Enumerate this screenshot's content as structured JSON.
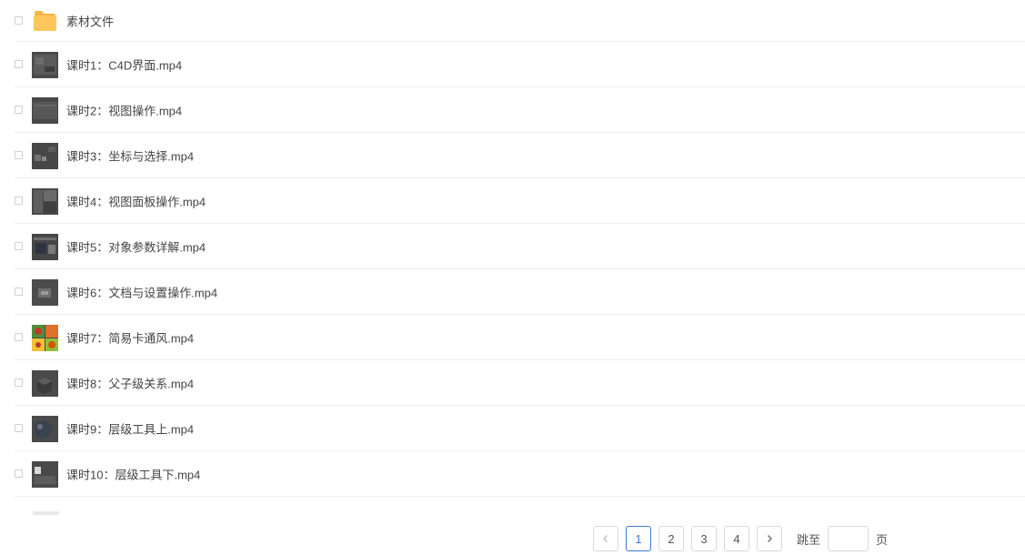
{
  "files": [
    {
      "name": "素材文件",
      "type": "folder",
      "icon": "folder-icon"
    },
    {
      "name": "课时1：C4D界面.mp4",
      "type": "video",
      "icon": "video-thumbnail-icon"
    },
    {
      "name": "课时2：视图操作.mp4",
      "type": "video",
      "icon": "video-thumbnail-icon"
    },
    {
      "name": "课时3：坐标与选择.mp4",
      "type": "video",
      "icon": "video-thumbnail-icon"
    },
    {
      "name": "课时4：视图面板操作.mp4",
      "type": "video",
      "icon": "video-thumbnail-icon"
    },
    {
      "name": "课时5：对象参数详解.mp4",
      "type": "video",
      "icon": "video-thumbnail-icon"
    },
    {
      "name": "课时6：文档与设置操作.mp4",
      "type": "video",
      "icon": "video-thumbnail-icon"
    },
    {
      "name": "课时7：简易卡通风.mp4",
      "type": "video",
      "icon": "video-thumbnail-icon"
    },
    {
      "name": "课时8：父子级关系.mp4",
      "type": "video",
      "icon": "video-thumbnail-icon"
    },
    {
      "name": "课时9：层级工具上.mp4",
      "type": "video",
      "icon": "video-thumbnail-icon"
    },
    {
      "name": "课时10：层级工具下.mp4",
      "type": "video",
      "icon": "video-thumbnail-icon"
    }
  ],
  "pagination": {
    "prev_icon": "chevron-left-icon",
    "next_icon": "chevron-right-icon",
    "pages": [
      "1",
      "2",
      "3",
      "4"
    ],
    "current_page": "1",
    "jump_label": "跳至",
    "jump_value": "",
    "page_unit": "页"
  },
  "colors": {
    "accent": "#3a7bd5",
    "folder": "#ffc65c",
    "divider": "#eeeeee"
  }
}
